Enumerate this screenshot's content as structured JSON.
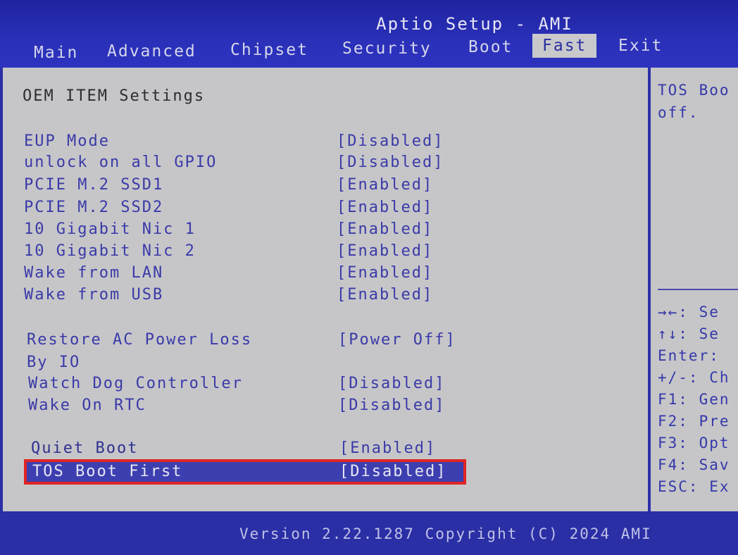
{
  "app": {
    "title": "Aptio Setup - AMI"
  },
  "tabs": [
    {
      "label": "Main"
    },
    {
      "label": "Advanced"
    },
    {
      "label": "Chipset"
    },
    {
      "label": "Security"
    },
    {
      "label": "Boot"
    },
    {
      "label": "Fast"
    },
    {
      "label": "Exit"
    }
  ],
  "active_tab": "Fast",
  "section_title": "OEM ITEM Settings",
  "settings": [
    {
      "label": "EUP Mode",
      "value": "[Disabled]"
    },
    {
      "label": "unlock on all GPIO",
      "value": "[Disabled]"
    },
    {
      "label": "PCIE M.2 SSD1",
      "value": "[Enabled]"
    },
    {
      "label": "PCIE M.2 SSD2",
      "value": "[Enabled]"
    },
    {
      "label": "10 Gigabit Nic 1",
      "value": "[Enabled]"
    },
    {
      "label": "10 Gigabit Nic 2",
      "value": "[Enabled]"
    },
    {
      "label": "Wake from LAN",
      "value": "[Enabled]"
    },
    {
      "label": "Wake from USB",
      "value": "[Enabled]"
    },
    {
      "label": "Restore AC Power Loss",
      "label2": "By IO",
      "value": "[Power Off]"
    },
    {
      "label": "Watch Dog Controller",
      "value": "[Disabled]"
    },
    {
      "label": "Wake On RTC",
      "value": "[Disabled]"
    },
    {
      "label": "Quiet Boot",
      "value": "[Enabled]"
    },
    {
      "label": "TOS Boot First",
      "value": "[Disabled]"
    }
  ],
  "help": {
    "line1": "TOS Boo",
    "line2": "off."
  },
  "keys": [
    {
      "text": "→←: Se"
    },
    {
      "text": "↑↓: Se"
    },
    {
      "text": "Enter:"
    },
    {
      "text": "+/-: Ch"
    },
    {
      "text": "F1: Gen"
    },
    {
      "text": "F2: Pre"
    },
    {
      "text": "F3: Opt"
    },
    {
      "text": "F4: Sav"
    },
    {
      "text": "ESC: Ex"
    }
  ],
  "footer": {
    "version": "Version 2.22.1287 Copyright (C) 2024 AMI"
  },
  "colors": {
    "header_blue": "#2a30b8",
    "panel_gray": "#c6c6c9",
    "highlight_red": "#e02424",
    "text_blue": "#3a3aa8"
  }
}
